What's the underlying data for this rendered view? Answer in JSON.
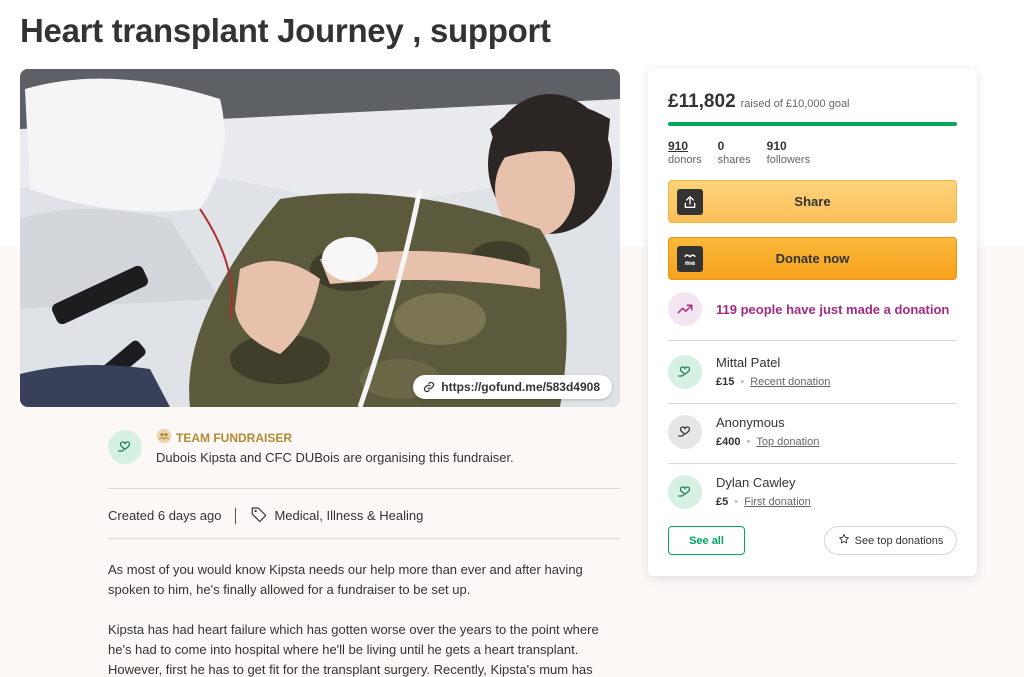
{
  "page": {
    "title": "Heart transplant Journey , support"
  },
  "hero": {
    "short_link": "https://gofund.me/583d4908"
  },
  "organiser": {
    "team_label": "TEAM FUNDRAISER",
    "text": "Dubois Kipsta and CFC DUBois are organising this fundraiser."
  },
  "meta": {
    "created": "Created 6 days ago",
    "category": "Medical, Illness & Healing"
  },
  "story": {
    "paragraphs": [
      "As most of you would know Kipsta needs our help more than ever and after having spoken to him, he's finally allowed for a fundraiser to be set up.",
      "Kipsta has had heart failure which has gotten worse over the years to the point where he's had to come into hospital where he'll be living until he gets a heart transplant. However, first he has to get fit for the transplant surgery. Recently, Kipsta's mum has"
    ]
  },
  "donation_card": {
    "raised": "£11,802",
    "goal_text": "raised of £10,000 goal",
    "progress_fraction": 1.0,
    "stats": [
      {
        "value": "910",
        "label": "donors"
      },
      {
        "value": "0",
        "label": "shares"
      },
      {
        "value": "910",
        "label": "followers"
      }
    ],
    "share_label": "Share",
    "donate_label": "Donate now",
    "recent_activity": "119 people have just made a donation",
    "donations": [
      {
        "name": "Mittal Patel",
        "amount": "£15",
        "tag": "Recent donation",
        "avatar": "heart-hand-icon"
      },
      {
        "name": "Anonymous",
        "amount": "£400",
        "tag": "Top donation",
        "avatar": "heart-hand-icon"
      },
      {
        "name": "Dylan Cawley",
        "amount": "£5",
        "tag": "First donation",
        "avatar": "heart-hand-icon"
      }
    ],
    "see_all_label": "See all",
    "see_top_label": "See top donations"
  },
  "colors": {
    "brand_green": "#02a95c",
    "donate_orange": "#f7a21d",
    "share_yellow": "#fbc05a",
    "recent_purple": "#a22b84",
    "team_gold": "#b28a35"
  }
}
